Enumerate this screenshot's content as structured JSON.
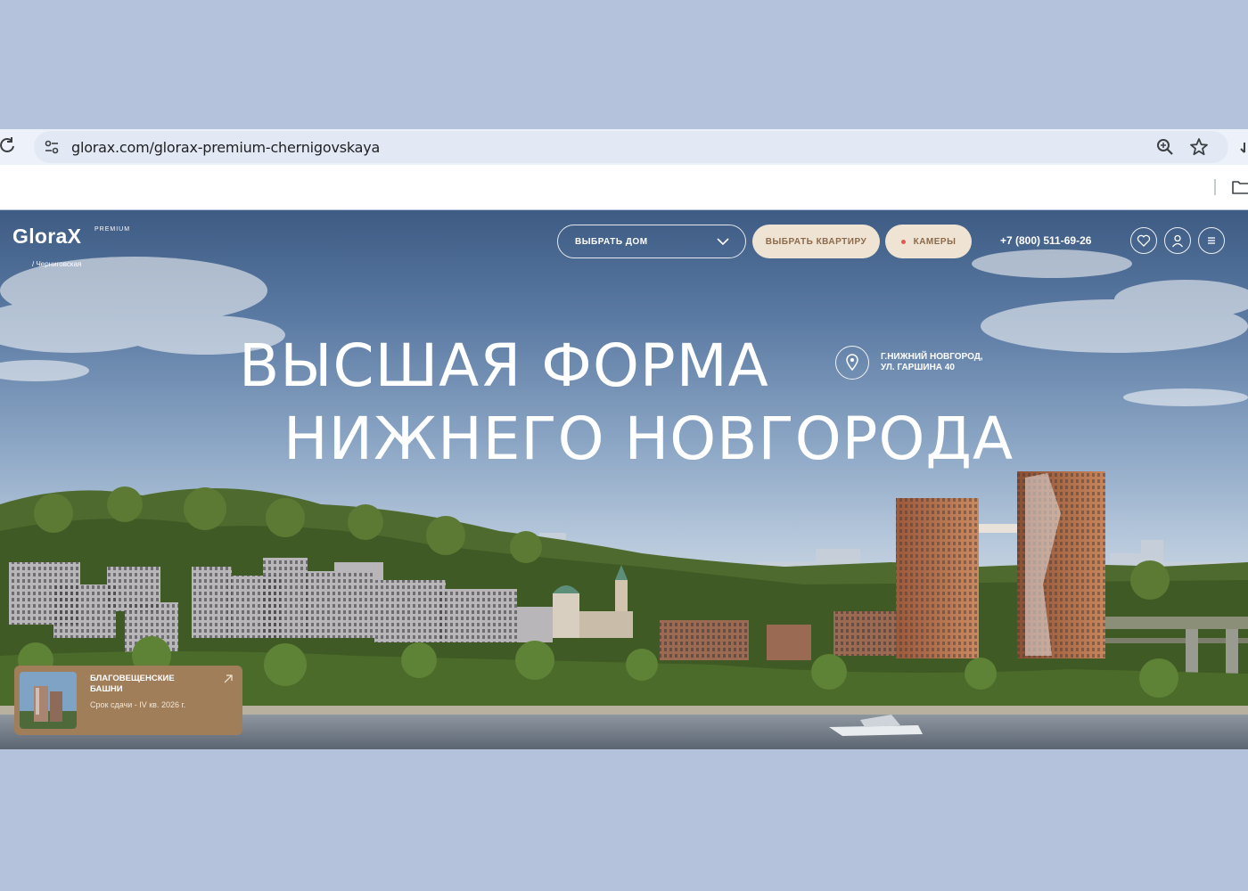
{
  "browser": {
    "url": "glorax.com/glorax-premium-chernigovskaya",
    "icons": {
      "reload": "reload-icon",
      "site_info": "tune-icon",
      "zoom": "zoom-icon",
      "bookmark": "star-icon",
      "folder": "folder-icon"
    }
  },
  "header": {
    "logo": {
      "main": "GloraX",
      "tag": "PREMIUM",
      "sub": "/ Черниговская"
    },
    "nav": {
      "select_house": "ВЫБРАТЬ ДОМ",
      "select_apartment": "ВЫБРАТЬ КВАРТИРУ",
      "cameras": "КАМЕРЫ"
    },
    "phone": "+7 (800) 511-69-26",
    "icons": [
      "heart-icon",
      "user-icon",
      "menu-icon"
    ]
  },
  "hero": {
    "title_line1": "ВЫСШАЯ ФОРМА",
    "title_line2": "НИЖНЕГО НОВГОРОДА",
    "address_line1": "Г.НИЖНИЙ НОВГОРОД,",
    "address_line2": "УЛ. ГАРШИНА 40"
  },
  "card": {
    "title": "БЛАГОВЕЩЕНСКИЕ БАШНИ",
    "date": "Срок сдачи - IV кв. 2026 г."
  },
  "colors": {
    "page_bg": "#b4c3db",
    "accent_beige": "#efe3d3",
    "accent_text": "#8b6a4c",
    "card_bg": "#a07e5a",
    "camera_dot": "#e45757"
  }
}
